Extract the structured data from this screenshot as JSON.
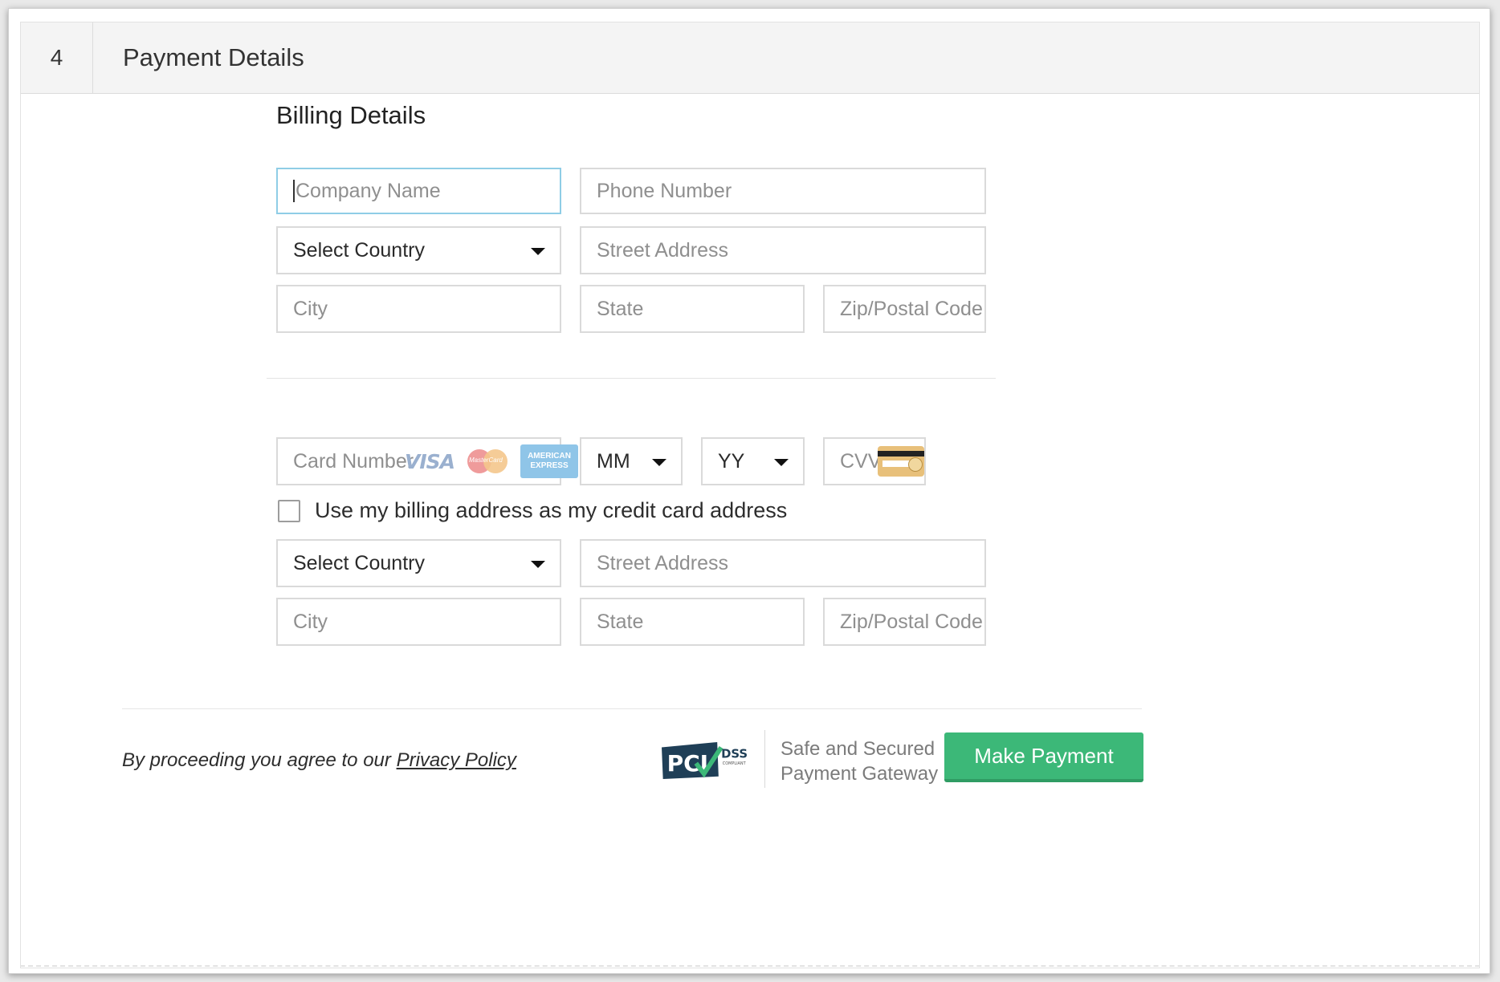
{
  "section": {
    "step": "4",
    "title": "Payment Details"
  },
  "billing": {
    "title": "Billing Details",
    "company_placeholder": "Company Name",
    "phone_placeholder": "Phone Number",
    "country_selected": "Select Country",
    "street_placeholder": "Street Address",
    "city_placeholder": "City",
    "state_placeholder": "State",
    "zip_placeholder": "Zip/Postal Code"
  },
  "card": {
    "number_placeholder": "Card Number",
    "logos": {
      "visa": "VISA",
      "mastercard": "MasterCard",
      "amex_line1": "AMERICAN",
      "amex_line2": "EXPRESS"
    },
    "month_selected": "MM",
    "year_selected": "YY",
    "cvv_placeholder": "CVV",
    "use_billing_label": "Use my billing address as my credit card address",
    "use_billing_checked": false,
    "country_selected": "Select Country",
    "street_placeholder": "Street Address",
    "city_placeholder": "City",
    "state_placeholder": "State",
    "zip_placeholder": "Zip/Postal Code"
  },
  "footer": {
    "agree_prefix": "By proceeding you agree to our ",
    "privacy_link": "Privacy Policy",
    "pci_letters": "PCI",
    "pci_dss": "DSS",
    "pci_compliant": "COMPLIANT",
    "secure_line1": "Safe and Secured",
    "secure_line2": "Payment Gateway",
    "pay_button": "Make Payment"
  },
  "colors": {
    "accent_green": "#3cb878",
    "focus_border": "#8fcde6",
    "header_bg": "#f4f4f4"
  },
  "icons": {
    "dropdown": "chevron-down-icon",
    "checkbox": "checkbox-icon",
    "cvv": "credit-card-back-icon",
    "pci": "pci-dss-logo"
  }
}
